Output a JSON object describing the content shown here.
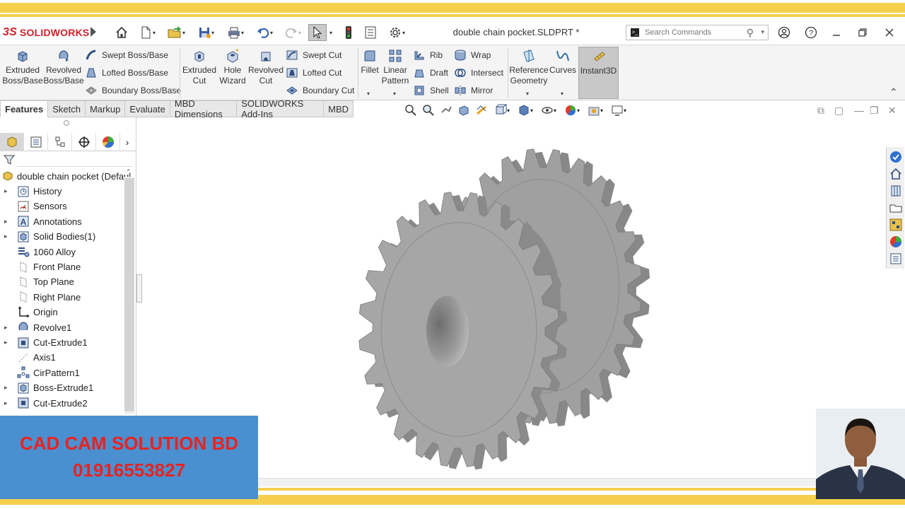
{
  "app": {
    "brand": "SOLIDWORKS",
    "brand_mark": "3S",
    "document_title": "double chain pocket.SLDPRT *"
  },
  "search": {
    "placeholder": "Search Commands"
  },
  "quick_access": [
    "home-icon",
    "new-document-icon",
    "open-folder-icon",
    "save-icon",
    "print-icon",
    "undo-icon",
    "redo-icon",
    "select-pointer-icon",
    "rebuild-traffic-light-icon",
    "file-properties-icon",
    "options-gear-icon"
  ],
  "ribbon": {
    "extruded_boss": "Extruded\nBoss/Base",
    "revolved_boss": "Revolved\nBoss/Base",
    "swept_boss": "Swept Boss/Base",
    "lofted_boss": "Lofted Boss/Base",
    "boundary_boss": "Boundary Boss/Base",
    "extruded_cut": "Extruded\nCut",
    "hole_wizard": "Hole\nWizard",
    "revolved_cut": "Revolved\nCut",
    "swept_cut": "Swept Cut",
    "lofted_cut": "Lofted Cut",
    "boundary_cut": "Boundary Cut",
    "fillet": "Fillet",
    "linear_pattern": "Linear\nPattern",
    "rib": "Rib",
    "draft": "Draft",
    "shell": "Shell",
    "wrap": "Wrap",
    "intersect": "Intersect",
    "mirror": "Mirror",
    "reference_geometry": "Reference\nGeometry",
    "curves": "Curves",
    "instant3d": "Instant3D"
  },
  "tabs": [
    "Features",
    "Sketch",
    "Markup",
    "Evaluate",
    "MBD Dimensions",
    "SOLIDWORKS Add-Ins",
    "MBD"
  ],
  "tree": {
    "root": "double chain pocket  (Defaul",
    "items": [
      {
        "label": "History",
        "expandable": true,
        "icon": "history-icon"
      },
      {
        "label": "Sensors",
        "expandable": false,
        "icon": "sensors-icon"
      },
      {
        "label": "Annotations",
        "expandable": true,
        "icon": "annotations-icon"
      },
      {
        "label": "Solid Bodies(1)",
        "expandable": true,
        "icon": "solid-bodies-icon"
      },
      {
        "label": "1060 Alloy",
        "expandable": false,
        "icon": "material-icon"
      },
      {
        "label": "Front Plane",
        "expandable": false,
        "icon": "plane-icon"
      },
      {
        "label": "Top Plane",
        "expandable": false,
        "icon": "plane-icon"
      },
      {
        "label": "Right Plane",
        "expandable": false,
        "icon": "plane-icon"
      },
      {
        "label": "Origin",
        "expandable": false,
        "icon": "origin-icon"
      },
      {
        "label": "Revolve1",
        "expandable": true,
        "icon": "revolve-icon"
      },
      {
        "label": "Cut-Extrude1",
        "expandable": true,
        "icon": "cut-extrude-icon"
      },
      {
        "label": "Axis1",
        "expandable": false,
        "icon": "axis-icon"
      },
      {
        "label": "CirPattern1",
        "expandable": false,
        "icon": "circular-pattern-icon"
      },
      {
        "label": "Boss-Extrude1",
        "expandable": true,
        "icon": "boss-extrude-icon"
      },
      {
        "label": "Cut-Extrude2",
        "expandable": true,
        "icon": "cut-extrude-icon"
      }
    ]
  },
  "overlay": {
    "line1": "CAD CAM SOLUTION BD",
    "line2": "01916553827"
  },
  "colors": {
    "accent_yellow": "#f6cf4c",
    "brand_red": "#d0202a",
    "banner_blue": "#4a90d0",
    "banner_text": "#e8231f",
    "part_gray": "#a0a0a0"
  }
}
